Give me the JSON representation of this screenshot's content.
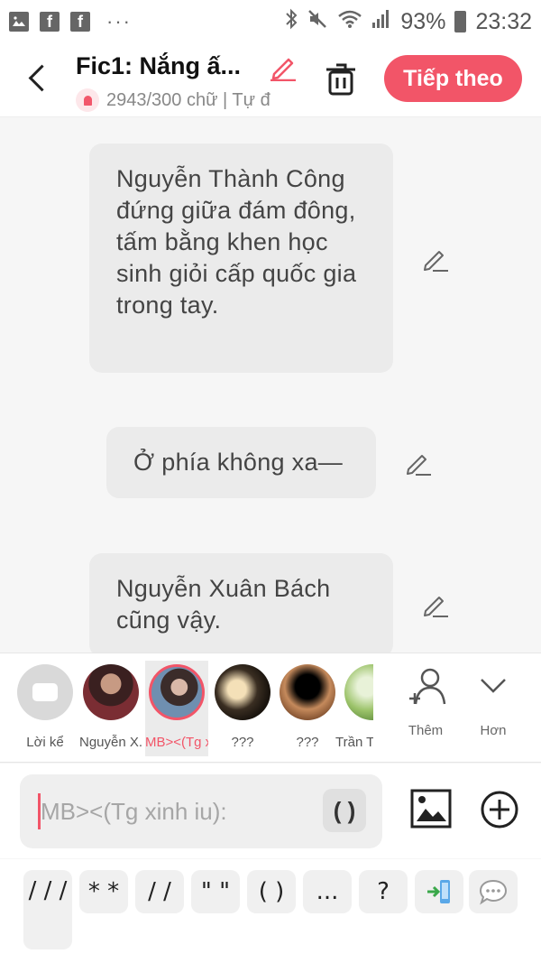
{
  "status_bar": {
    "battery": "93%",
    "time": "23:32",
    "dots": "···"
  },
  "header": {
    "title": "Fic1: Nắng ấ...",
    "subtitle": "2943/300 chữ | Tự đ",
    "next_label": "Tiếp theo"
  },
  "messages": [
    {
      "text": "Nguyễn Thành Công đứng giữa đám đông, tấm bằng khen học sinh giỏi cấp quốc gia trong tay."
    },
    {
      "text": "Ở phía không xa—"
    },
    {
      "text": "Nguyễn Xuân Bách cũng vậy."
    }
  ],
  "characters": [
    {
      "label": "Lời kể"
    },
    {
      "label": "Nguyễn X..."
    },
    {
      "label": "MB><(Tg x..."
    },
    {
      "label": "???"
    },
    {
      "label": "???"
    },
    {
      "label": "Trần T"
    }
  ],
  "actions": {
    "add_label": "Thêm",
    "more_label": "Hơn"
  },
  "input": {
    "placeholder": "MB><(Tg xinh iu):",
    "paren_label": "( )"
  },
  "quick_keys": {
    "slash3": "/ / /",
    "stars": "* *",
    "slash2": "/ /",
    "quotes": "\" \"",
    "parens": "( )",
    "ellipsis": "...",
    "question": "?"
  },
  "colors": {
    "accent": "#f25568",
    "bubble": "#ebebeb",
    "background": "#f6f6f6"
  }
}
